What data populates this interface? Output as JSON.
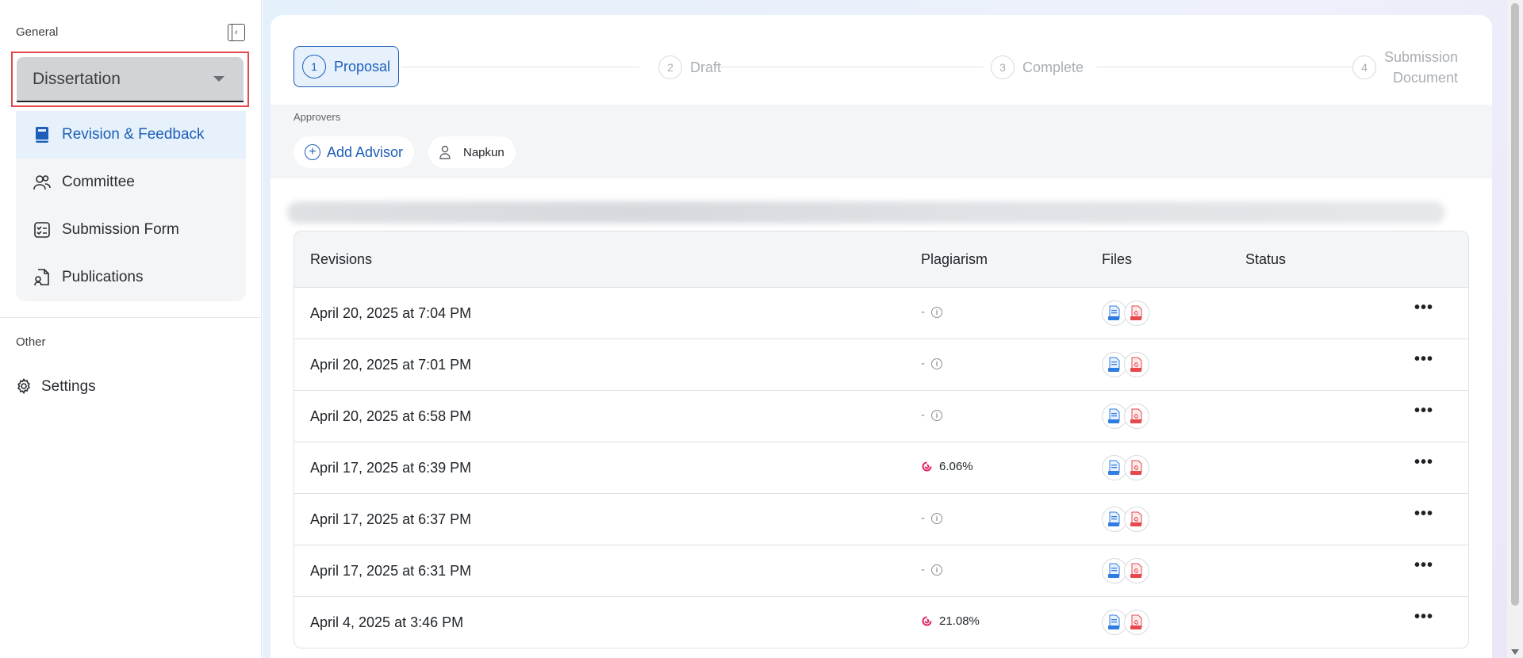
{
  "sidebar": {
    "general_label": "General",
    "other_label": "Other",
    "program_select": {
      "value": "Dissertation"
    },
    "items": [
      {
        "label": "Revision & Feedback",
        "icon": "book-icon",
        "active": true
      },
      {
        "label": "Committee",
        "icon": "people-icon",
        "active": false
      },
      {
        "label": "Submission Form",
        "icon": "checklist-icon",
        "active": false
      },
      {
        "label": "Publications",
        "icon": "document-person-icon",
        "active": false
      }
    ],
    "settings_label": "Settings"
  },
  "steps": [
    {
      "num": "1",
      "label": "Proposal",
      "active": true
    },
    {
      "num": "2",
      "label": "Draft",
      "active": false
    },
    {
      "num": "3",
      "label": "Complete",
      "active": false
    },
    {
      "num": "4",
      "label_line1": "Submission",
      "label_line2": "Document",
      "active": false
    }
  ],
  "approvers": {
    "label": "Approvers",
    "add_label": "Add Advisor",
    "person_name": "Napkun"
  },
  "table": {
    "headers": {
      "revisions": "Revisions",
      "plagiarism": "Plagiarism",
      "files": "Files",
      "status": "Status"
    },
    "rows": [
      {
        "date": "April 20, 2025 at 7:04 PM",
        "plagiarism": "-",
        "has_score": false,
        "status": ""
      },
      {
        "date": "April 20, 2025 at 7:01 PM",
        "plagiarism": "-",
        "has_score": false,
        "status": ""
      },
      {
        "date": "April 20, 2025 at 6:58 PM",
        "plagiarism": "-",
        "has_score": false,
        "status": ""
      },
      {
        "date": "April 17, 2025 at 6:39 PM",
        "plagiarism": "6.06%",
        "has_score": true,
        "status": ""
      },
      {
        "date": "April 17, 2025 at 6:37 PM",
        "plagiarism": "-",
        "has_score": false,
        "status": ""
      },
      {
        "date": "April 17, 2025 at 6:31 PM",
        "plagiarism": "-",
        "has_score": false,
        "status": ""
      },
      {
        "date": "April 4, 2025 at 3:46 PM",
        "plagiarism": "21.08%",
        "has_score": true,
        "status": ""
      }
    ],
    "file_icons": [
      "docx-file-icon",
      "pdf-file-icon"
    ],
    "more_glyph": "•••"
  },
  "colors": {
    "accent": "#1d5fb8",
    "active_bg": "#e6f1fc",
    "highlight_border": "#e5484d",
    "plagiarism_icon": "#e0245e"
  }
}
